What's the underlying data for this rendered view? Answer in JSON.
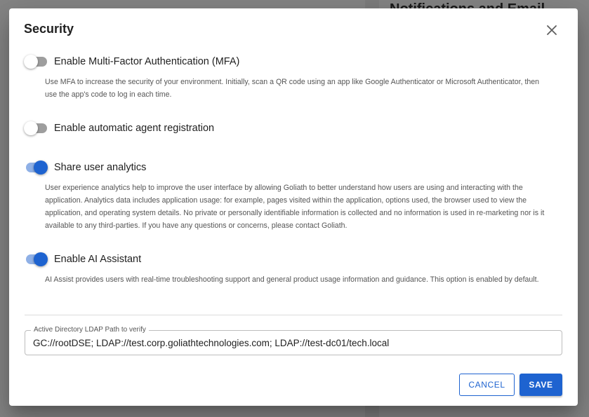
{
  "dialog": {
    "title": "Security",
    "close_icon": "close-icon"
  },
  "settings": [
    {
      "label": "Enable Multi-Factor Authentication (MFA)",
      "enabled": false,
      "description": "Use MFA to increase the security of your environment. Initially, scan a QR code using an app like Google Authenticator or Microsoft Authenticator, then use the app's code to log in each time."
    },
    {
      "label": "Enable automatic agent registration",
      "enabled": false,
      "description": ""
    },
    {
      "label": "Share user analytics",
      "enabled": true,
      "description": "User experience analytics help to improve the user interface by allowing Goliath to better understand how users are using and interacting with the application. Analytics data includes application usage: for example, pages visited within the application, options used, the browser used to view the application, and operating system details. No private or personally identifiable information is collected and no information is used in re-marketing nor is it available to any third-parties. If you have any questions or concerns, please contact Goliath."
    },
    {
      "label": "Enable AI Assistant",
      "enabled": true,
      "description": "AI Assist provides users with real-time troubleshooting support and general product usage information and guidance. This option is enabled by default."
    }
  ],
  "ldap": {
    "label": "Active Directory LDAP Path to verify",
    "value": "GC://rootDSE; LDAP://test.corp.goliathtechnologies.com; LDAP://test-dc01/tech.local"
  },
  "buttons": {
    "cancel": "CANCEL",
    "save": "SAVE"
  },
  "background": {
    "right_title": "Notifications and Email"
  },
  "colors": {
    "accent": "#1e63d0",
    "toggle_on_track": "#8fb0e6",
    "toggle_off_track": "#9e9e9e"
  }
}
